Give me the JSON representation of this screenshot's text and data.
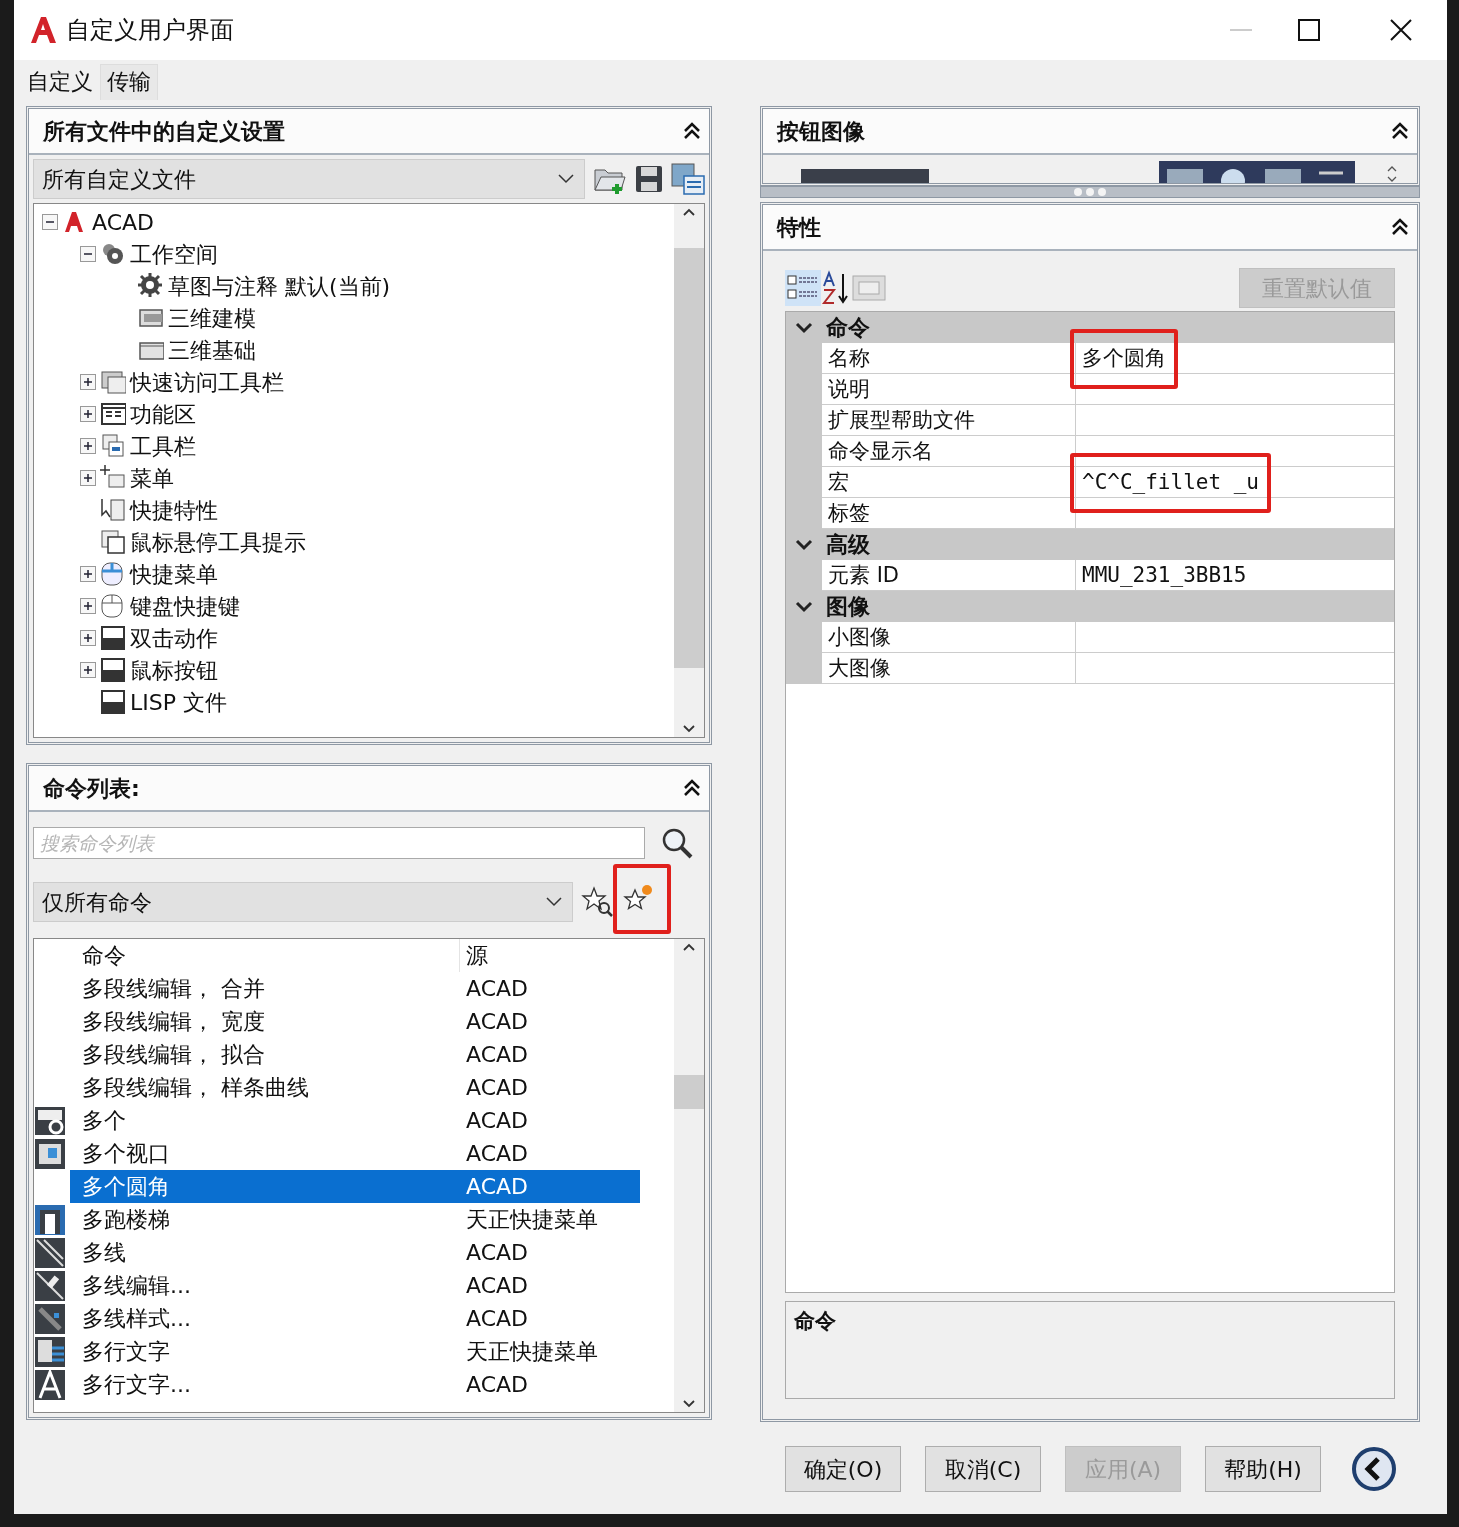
{
  "window": {
    "title": "自定义用户界面"
  },
  "tabs": [
    {
      "label": "自定义",
      "selected": true
    },
    {
      "label": "传输",
      "selected": false
    }
  ],
  "customizations": {
    "title": "所有文件中的自定义设置",
    "file_select": "所有自定义文件",
    "tree": [
      {
        "label": "ACAD",
        "expanded": true,
        "children": [
          {
            "label": "工作空间",
            "expanded": true,
            "children": [
              {
                "label": "草图与注释  默认(当前)"
              },
              {
                "label": "三维建模"
              },
              {
                "label": "三维基础"
              }
            ]
          },
          {
            "label": "快速访问工具栏",
            "expanded": false
          },
          {
            "label": "功能区",
            "expanded": false
          },
          {
            "label": "工具栏",
            "expanded": false
          },
          {
            "label": "菜单",
            "expanded": false
          },
          {
            "label": "快捷特性"
          },
          {
            "label": "鼠标悬停工具提示"
          },
          {
            "label": "快捷菜单",
            "expanded": false
          },
          {
            "label": "键盘快捷键",
            "expanded": false
          },
          {
            "label": "双击动作",
            "expanded": false
          },
          {
            "label": "鼠标按钮",
            "expanded": false
          },
          {
            "label": "LISP 文件"
          }
        ]
      }
    ]
  },
  "command_list": {
    "title": "命令列表:",
    "search": {
      "placeholder": "搜索命令列表"
    },
    "filter": "仅所有命令",
    "new_command_highlighted": true,
    "columns": [
      "命令",
      "源"
    ],
    "rows": [
      {
        "command": "多段线编辑， 合并",
        "source": "ACAD",
        "icon": false,
        "selected": false
      },
      {
        "command": "多段线编辑， 宽度",
        "source": "ACAD",
        "icon": false,
        "selected": false
      },
      {
        "command": "多段线编辑， 拟合",
        "source": "ACAD",
        "icon": false,
        "selected": false
      },
      {
        "command": "多段线编辑， 样条曲线",
        "source": "ACAD",
        "icon": false,
        "selected": false
      },
      {
        "command": "多个",
        "source": "ACAD",
        "icon": true,
        "selected": false
      },
      {
        "command": "多个视口",
        "source": "ACAD",
        "icon": true,
        "selected": false
      },
      {
        "command": "多个圆角",
        "source": "ACAD",
        "icon": false,
        "selected": true
      },
      {
        "command": "多跑楼梯",
        "source": "天正快捷菜单",
        "icon": true,
        "selected": false
      },
      {
        "command": "多线",
        "source": "ACAD",
        "icon": true,
        "selected": false
      },
      {
        "command": "多线编辑...",
        "source": "ACAD",
        "icon": true,
        "selected": false
      },
      {
        "command": "多线样式...",
        "source": "ACAD",
        "icon": true,
        "selected": false
      },
      {
        "command": "多行文字",
        "source": "天正快捷菜单",
        "icon": true,
        "selected": false
      },
      {
        "command": "多行文字...",
        "source": "ACAD",
        "icon": true,
        "selected": false
      }
    ]
  },
  "button_image": {
    "title": "按钮图像"
  },
  "properties": {
    "title": "特性",
    "reset_button": {
      "label": "重置默认值",
      "disabled": true
    },
    "sections": [
      {
        "title": "命令",
        "expanded": true,
        "rows": [
          {
            "name": "名称",
            "value": "多个圆角",
            "highlighted": true
          },
          {
            "name": "说明",
            "value": "",
            "highlighted": false
          },
          {
            "name": "扩展型帮助文件",
            "value": "",
            "highlighted": false
          },
          {
            "name": "命令显示名",
            "value": "",
            "highlighted": false
          },
          {
            "name": "宏",
            "value": "^C^C_fillet _u",
            "highlighted": true
          },
          {
            "name": "标签",
            "value": "",
            "highlighted": false
          }
        ]
      },
      {
        "title": "高级",
        "expanded": true,
        "rows": [
          {
            "name": "元素 ID",
            "value": "MMU_231_3BB15",
            "highlighted": false
          }
        ]
      },
      {
        "title": "图像",
        "expanded": true,
        "rows": [
          {
            "name": "小图像",
            "value": "",
            "highlighted": false
          },
          {
            "name": "大图像",
            "value": "",
            "highlighted": false
          }
        ]
      }
    ],
    "description_title": "命令"
  },
  "buttons": [
    {
      "label": "确定(O)",
      "disabled": false
    },
    {
      "label": "取消(C)",
      "disabled": false
    },
    {
      "label": "应用(A)",
      "disabled": true
    },
    {
      "label": "帮助(H)",
      "disabled": false
    }
  ]
}
